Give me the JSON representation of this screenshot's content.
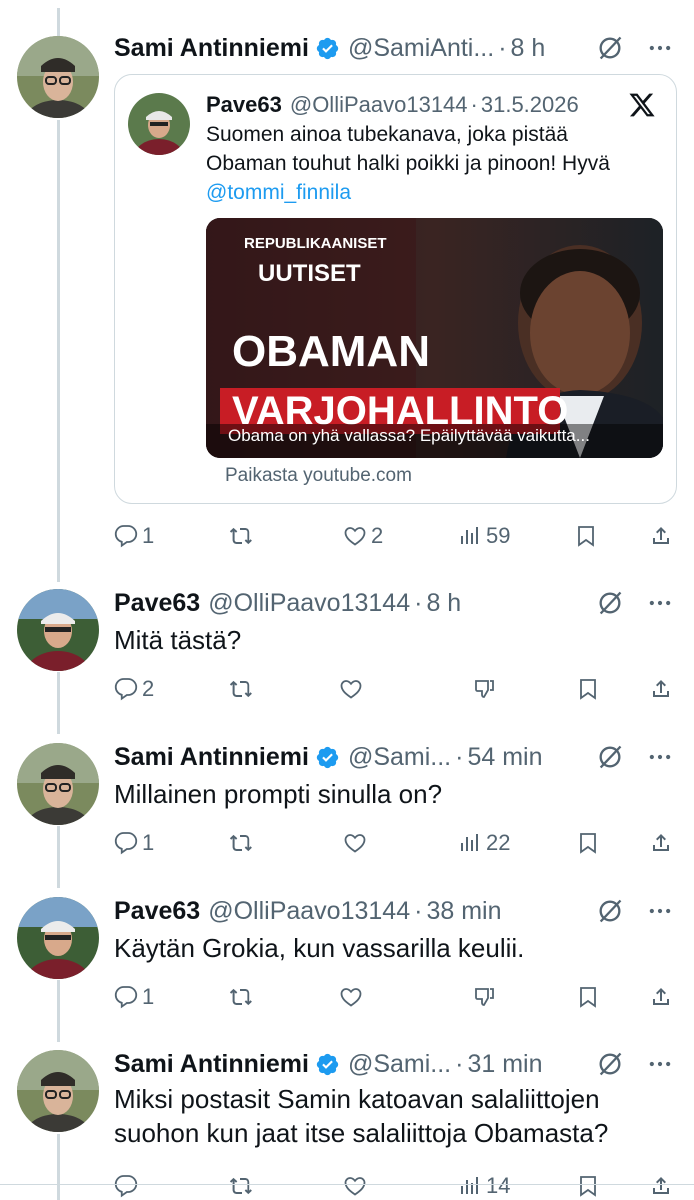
{
  "tweets": [
    {
      "name": "Sami Antinniemi",
      "handle": "@SamiAnti...",
      "time": "8 h",
      "verified": true,
      "quote": {
        "name": "Pave63",
        "handle": "@OlliPaavo13144",
        "date": "31.5.2026",
        "text": "Suomen ainoa tubekanava, joka pistää Obaman touhut halki poikki ja pinoon! Hyvä",
        "mention": "@tommi_finnila",
        "thumb_line1": "REPUBLIKAANISET",
        "thumb_line2": "UUTISET",
        "thumb_title1": "OBAMAN",
        "thumb_title2": "VARJOHALLINTO",
        "thumb_caption": "Obama on yhä vallassa? Epäilyttävää vaikutta...",
        "source": "Paikasta youtube.com"
      },
      "replies": "1",
      "reposts": "",
      "likes": "2",
      "views": "59"
    },
    {
      "name": "Pave63",
      "handle": "@OlliPaavo13144",
      "time": "8 h",
      "verified": false,
      "text": "Mitä tästä?",
      "replies": "2",
      "reposts": "",
      "likes": ""
    },
    {
      "name": "Sami Antinniemi",
      "handle": "@Sami...",
      "time": "54 min",
      "verified": true,
      "text": "Millainen prompti sinulla on?",
      "replies": "1",
      "reposts": "",
      "likes": "",
      "views": "22"
    },
    {
      "name": "Pave63",
      "handle": "@OlliPaavo13144",
      "time": "38 min",
      "verified": false,
      "text": "Käytän Grokia, kun vassarilla keulii.",
      "replies": "1",
      "reposts": "",
      "likes": ""
    },
    {
      "name": "Sami Antinniemi",
      "handle": "@Sami...",
      "time": "31 min",
      "verified": true,
      "text": "Miksi postasit Samin katoavan salaliittojen suohon kun jaat itse salaliittoja Obamasta?",
      "replies": "",
      "reposts": "",
      "likes": "",
      "views": "14"
    }
  ],
  "colors": {
    "accent": "#1d9bf0",
    "secondary_text": "#536471",
    "primary_text": "#0f1419",
    "border": "#cfd9de"
  },
  "icons": [
    "reply-icon",
    "repost-icon",
    "like-icon",
    "views-icon",
    "bookmark-icon",
    "share-icon",
    "dislike-icon",
    "grok-icon",
    "more-icon",
    "verified-icon",
    "x-logo-icon"
  ]
}
